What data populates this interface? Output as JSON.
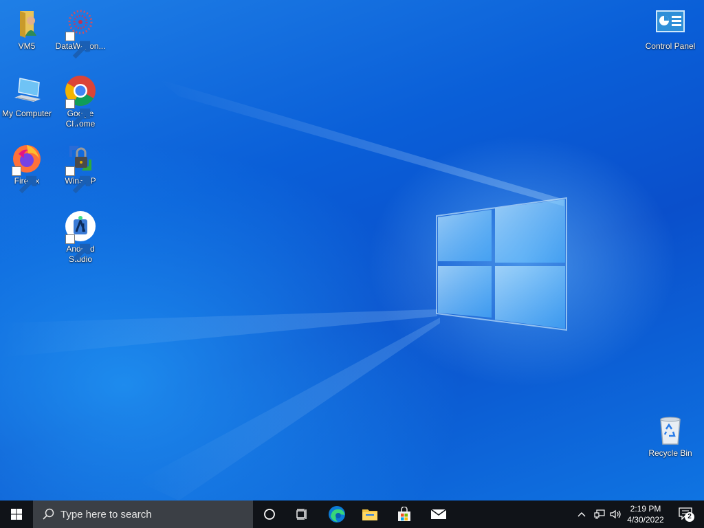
{
  "desktop": {
    "icons": [
      {
        "label": "VM5",
        "icon": "user-folder-icon"
      },
      {
        "label": "DataWagon...",
        "icon": "datawagon-icon"
      },
      {
        "label": "My Computer",
        "icon": "computer-icon"
      },
      {
        "label": "Google Chrome",
        "icon": "chrome-icon"
      },
      {
        "label": "Firefox",
        "icon": "firefox-icon"
      },
      {
        "label": "WinSCP",
        "icon": "winscp-icon"
      },
      {
        "label": "Android Studio",
        "icon": "android-studio-icon"
      },
      {
        "label": "Control Panel",
        "icon": "control-panel-icon"
      },
      {
        "label": "Recycle Bin",
        "icon": "recycle-bin-icon"
      }
    ]
  },
  "taskbar": {
    "search_placeholder": "Type here to search",
    "pinned": [
      "cortana-icon",
      "task-view-icon",
      "edge-icon",
      "file-explorer-icon",
      "microsoft-store-icon",
      "mail-icon"
    ],
    "clock": {
      "time": "2:19 PM",
      "date": "4/30/2022"
    },
    "notification_count": "2"
  },
  "colors": {
    "taskbar_bg": "#101318",
    "search_bg": "#3b3f45",
    "desktop_accent": "#0a5fd8"
  }
}
